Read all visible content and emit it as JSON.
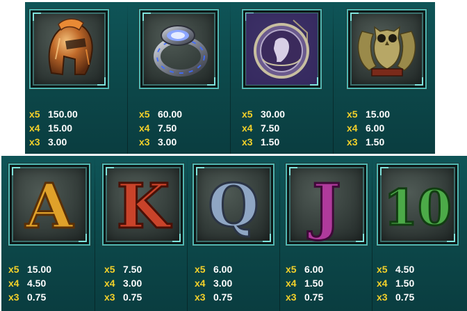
{
  "symbols_top": [
    {
      "name": "Helmet",
      "icon": "helmet-icon",
      "pays": [
        {
          "mult": "x5",
          "amount": "150.00"
        },
        {
          "mult": "x4",
          "amount": "15.00"
        },
        {
          "mult": "x3",
          "amount": "3.00"
        }
      ]
    },
    {
      "name": "Ring",
      "icon": "ring-icon",
      "pays": [
        {
          "mult": "x5",
          "amount": "60.00"
        },
        {
          "mult": "x4",
          "amount": "7.50"
        },
        {
          "mult": "x3",
          "amount": "3.00"
        }
      ]
    },
    {
      "name": "Coin",
      "icon": "coin-icon",
      "pays": [
        {
          "mult": "x5",
          "amount": "30.00"
        },
        {
          "mult": "x4",
          "amount": "7.50"
        },
        {
          "mult": "x3",
          "amount": "1.50"
        }
      ]
    },
    {
      "name": "Owl",
      "icon": "owl-icon",
      "pays": [
        {
          "mult": "x5",
          "amount": "15.00"
        },
        {
          "mult": "x4",
          "amount": "6.00"
        },
        {
          "mult": "x3",
          "amount": "1.50"
        }
      ]
    }
  ],
  "symbols_bottom": [
    {
      "letter": "A",
      "color": "#e0a12a",
      "pays": [
        {
          "mult": "x5",
          "amount": "15.00"
        },
        {
          "mult": "x4",
          "amount": "4.50"
        },
        {
          "mult": "x3",
          "amount": "0.75"
        }
      ]
    },
    {
      "letter": "K",
      "color": "#c9432a",
      "pays": [
        {
          "mult": "x5",
          "amount": "7.50"
        },
        {
          "mult": "x4",
          "amount": "3.00"
        },
        {
          "mult": "x3",
          "amount": "0.75"
        }
      ]
    },
    {
      "letter": "Q",
      "color": "#8fa6c4",
      "pays": [
        {
          "mult": "x5",
          "amount": "6.00"
        },
        {
          "mult": "x4",
          "amount": "3.00"
        },
        {
          "mult": "x3",
          "amount": "0.75"
        }
      ]
    },
    {
      "letter": "J",
      "color": "#b03a9c",
      "pays": [
        {
          "mult": "x5",
          "amount": "6.00"
        },
        {
          "mult": "x4",
          "amount": "1.50"
        },
        {
          "mult": "x3",
          "amount": "0.75"
        }
      ]
    },
    {
      "letter": "10",
      "color": "#4caa48",
      "pays": [
        {
          "mult": "x5",
          "amount": "4.50"
        },
        {
          "mult": "x4",
          "amount": "1.50"
        },
        {
          "mult": "x3",
          "amount": "0.75"
        }
      ]
    }
  ]
}
